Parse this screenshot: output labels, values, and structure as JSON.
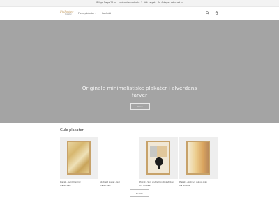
{
  "announcement": {
    "text": "Billige Dage 25 kr. - ved ordre under kr. 1 - frit salget - De 4 dages retur ret →"
  },
  "header": {
    "logo_text": "PixPoster",
    "logo_sub": "Plakater",
    "nav": [
      {
        "label": "Flere plakater",
        "has_dropdown": true
      },
      {
        "label": "Kontakt",
        "has_dropdown": false
      }
    ],
    "icons": [
      "search-icon",
      "cart-icon"
    ]
  },
  "hero": {
    "title": "Originale minimalistiske plakater i alverdens farver",
    "button_label": "Shop"
  },
  "collection": {
    "title": "Gule plakater",
    "products": [
      {
        "name": "Plakat - Gold marmor",
        "price": "Fra 95 DKK"
      },
      {
        "name": "Abstrakt plakat - Gul",
        "price": "Fra 95 DKK"
      },
      {
        "name": "Plakat - Sort and lemonstinkstriben",
        "price": "Fra 95 DKK"
      },
      {
        "name": "Plakat - Abstract gul og grøn",
        "price": "Fra 95 DKK"
      }
    ],
    "see_all_label": "Se alle"
  }
}
